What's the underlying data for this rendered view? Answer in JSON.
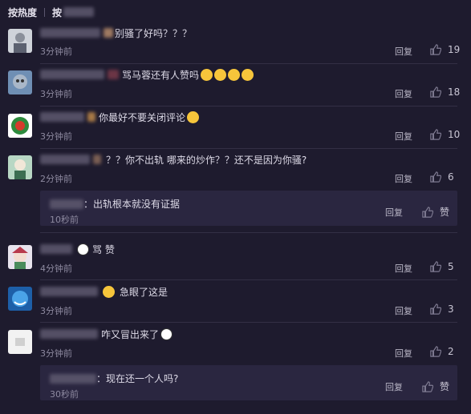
{
  "tabs": [
    {
      "label": "按热度"
    },
    {
      "label": "按"
    }
  ],
  "like_icon": "thumb-up-icon",
  "colors": {
    "background": "#1e1b2e",
    "subbox": "#2a2640",
    "divider": "#332f45"
  },
  "comments": [
    {
      "text": "别骚了好吗？？？",
      "time": "3分钟前",
      "reply": "回复",
      "likes": "19"
    },
    {
      "text": "骂马蓉还有人赞吗",
      "time": "3分钟前",
      "reply": "回复",
      "likes": "18"
    },
    {
      "text": "你最好不要关闭评论",
      "time": "3分钟前",
      "reply": "回复",
      "likes": "10"
    },
    {
      "text": "？？你不出轨 哪来的炒作？？还不是因为你骚?",
      "time": "2分钟前",
      "reply": "回复",
      "likes": "6"
    },
    {
      "text": "骂 赞",
      "time": "4分钟前",
      "reply": "回复",
      "likes": "5"
    },
    {
      "text": "急眼了这是",
      "time": "3分钟前",
      "reply": "回复",
      "likes": "3"
    },
    {
      "text": "咋又冒出来了",
      "time": "3分钟前",
      "reply": "回复",
      "likes": "2"
    }
  ],
  "subreplies": [
    {
      "text": "：出轨根本就没有证据",
      "time": "10秒前",
      "reply": "回复",
      "like": "赞"
    },
    {
      "text": "：现在还一个人吗?",
      "time": "30秒前",
      "reply": "回复",
      "like": "赞"
    }
  ]
}
